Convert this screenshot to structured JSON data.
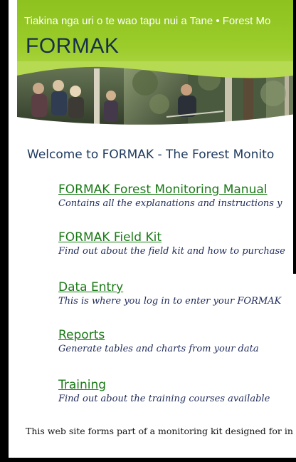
{
  "header": {
    "tagline": "Tiakina nga uri o te wao tapu nui a Tane • Forest Mo",
    "logo": "FORMAK"
  },
  "welcome": "Welcome to FORMAK - The Forest Monito",
  "links": [
    {
      "label": "FORMAK Forest Monitoring Manual",
      "desc": "Contains all the explanations and instructions y"
    },
    {
      "label": "FORMAK Field Kit",
      "desc": "Find out about the field kit and how to purchase"
    },
    {
      "label": "Data Entry",
      "desc": "This is where you log in to enter your FORMAK"
    },
    {
      "label": "Reports",
      "desc": "Generate tables and charts from your data"
    },
    {
      "label": "Training",
      "desc": "Find out about the training courses available"
    }
  ],
  "footer": "This web site forms part of a monitoring kit designed for in"
}
